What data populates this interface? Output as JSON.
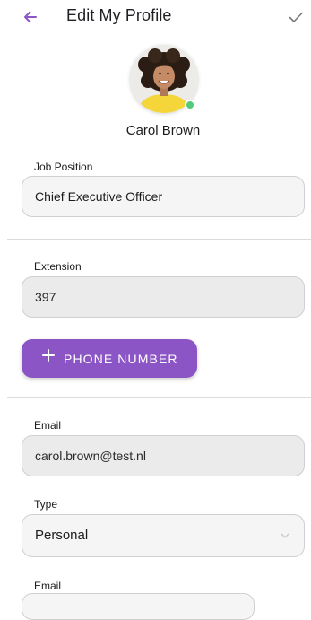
{
  "header": {
    "title": "Edit My Profile",
    "back_icon": "arrow-left-icon",
    "confirm_icon": "checkmark-icon"
  },
  "profile": {
    "name": "Carol Brown",
    "status": "online",
    "status_color": "#53c97a"
  },
  "job_position": {
    "label": "Job Position",
    "value": "Chief Executive Officer"
  },
  "extension": {
    "label": "Extension",
    "value": "397"
  },
  "phone": {
    "add_label": "PHONE NUMBER",
    "plus_icon": "plus-icon"
  },
  "emails": [
    {
      "label": "Email",
      "value": "carol.brown@test.nl",
      "type_label": "Type",
      "type_value": "Personal"
    },
    {
      "label": "Email",
      "value": ""
    }
  ],
  "colors": {
    "accent": "#8c55c6",
    "field_bg": "#f5f5f5",
    "field_disabled_bg": "#ebebeb",
    "divider": "#dcdcdc"
  }
}
